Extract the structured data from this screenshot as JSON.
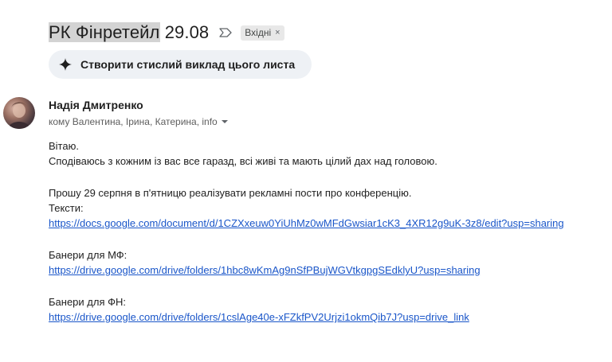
{
  "subject": {
    "title_part1": "РК Фінретейл",
    "title_part2": " 29.08",
    "label": "Вхідні",
    "label_remove": "×"
  },
  "summarize": {
    "label": "Створити стислий виклад цього листа"
  },
  "sender": {
    "name": "Надія Дмитренко",
    "recipients": "кому Валентина, Ірина, Катерина, info"
  },
  "body": {
    "greeting": "Вітаю.",
    "line1": "Сподіваюсь з кожним із вас все гаразд, всі живі та мають цілий дах над головою.",
    "line2": "Прошу 29 серпня в п'ятницю реалізувати рекламні пости про конференцію.",
    "texts_label": "Тексти:",
    "texts_link": "https://docs.google.com/document/d/1CZXxeuw0YiUhMz0wMFdGwsiar1cK3_4XR12g9uK-3z8/edit?usp=sharing",
    "banners_mf_label": "Банери для МФ:",
    "banners_mf_link": "https://drive.google.com/drive/folders/1hbc8wKmAg9nSfPBujWGVtkgpgSEdklyU?usp=sharing",
    "banners_fn_label": "Банери для ФН:",
    "banners_fn_link": "https://drive.google.com/drive/folders/1cslAge40e-xFZkfPV2Urjzi1okmQib7J?usp=drive_link"
  },
  "icons": {
    "important": "important-marker-icon",
    "spark": "sparkle-icon",
    "caret": "caret-down-icon"
  }
}
